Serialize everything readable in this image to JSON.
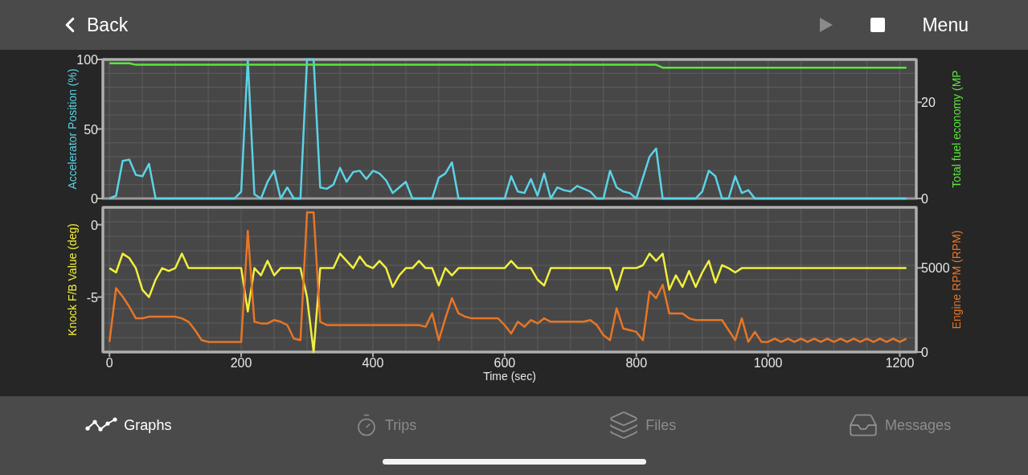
{
  "top_bar": {
    "back": {
      "label": "Back"
    },
    "play_button": {
      "disabled": true
    },
    "stop_button": {
      "disabled": false
    },
    "menu": {
      "label": "Menu"
    }
  },
  "charts": [
    {
      "chart_data": {
        "type": "line",
        "grid": true,
        "ylim": [
          0,
          100
        ],
        "yticks": [
          0,
          50,
          100
        ],
        "y2lim": [
          0,
          28.9
        ],
        "y2ticks": [
          0,
          20
        ],
        "xlim": [
          -10,
          1225
        ],
        "x": [
          0,
          10,
          20,
          30,
          40,
          50,
          60,
          70,
          80,
          90,
          100,
          110,
          120,
          130,
          140,
          150,
          160,
          170,
          180,
          190,
          200,
          210,
          220,
          230,
          240,
          250,
          260,
          270,
          280,
          290,
          300,
          310,
          320,
          330,
          340,
          350,
          360,
          370,
          380,
          390,
          400,
          410,
          420,
          430,
          440,
          450,
          460,
          470,
          480,
          490,
          500,
          510,
          520,
          530,
          540,
          550,
          560,
          570,
          580,
          590,
          600,
          610,
          620,
          630,
          640,
          650,
          660,
          670,
          680,
          690,
          700,
          710,
          720,
          730,
          740,
          750,
          760,
          770,
          780,
          790,
          800,
          810,
          820,
          830,
          840,
          850,
          860,
          870,
          880,
          890,
          900,
          910,
          920,
          930,
          940,
          950,
          960,
          970,
          980,
          990,
          1000,
          1010,
          1020,
          1030,
          1040,
          1050,
          1060,
          1070,
          1080,
          1090,
          1100,
          1110,
          1120,
          1130,
          1140,
          1150,
          1160,
          1170,
          1180,
          1190,
          1200,
          1210
        ],
        "series": [
          {
            "name": "Accelerator Position (%)",
            "color": "#5bd3e6",
            "values": [
              0,
              2,
              27,
              28,
              17,
              16,
              25,
              0,
              0,
              0,
              0,
              0,
              0,
              0,
              0,
              0,
              0,
              0,
              0,
              0,
              5,
              100,
              3,
              0,
              12,
              20,
              0,
              8,
              0,
              0,
              100,
              100,
              8,
              7,
              10,
              22,
              12,
              19,
              20,
              14,
              20,
              18,
              13,
              4,
              8,
              12,
              0,
              0,
              0,
              0,
              15,
              18,
              26,
              0,
              0,
              0,
              0,
              0,
              0,
              0,
              0,
              16,
              5,
              4,
              14,
              2,
              18,
              0,
              8,
              6,
              5,
              9,
              7,
              5,
              0,
              0,
              20,
              8,
              5,
              4,
              0,
              15,
              30,
              36,
              0,
              0,
              0,
              0,
              0,
              0,
              5,
              20,
              16,
              0,
              0,
              16,
              4,
              6,
              0,
              0,
              0,
              0,
              0,
              0,
              0,
              0,
              0,
              0,
              0,
              0,
              0,
              0,
              0,
              0,
              0,
              0,
              0,
              0,
              0,
              0,
              0,
              0
            ]
          },
          {
            "name": "Total fuel economy (MP",
            "axis": "y2",
            "color": "#5ae63c",
            "values": [
              28.1,
              28.1,
              28.1,
              28.1,
              27.8,
              27.8,
              27.8,
              27.8,
              27.8,
              27.8,
              27.8,
              27.8,
              27.8,
              27.8,
              27.8,
              27.8,
              27.8,
              27.8,
              27.8,
              27.8,
              27.8,
              27.8,
              27.8,
              27.8,
              27.8,
              27.8,
              27.8,
              27.8,
              27.8,
              27.8,
              27.8,
              27.8,
              27.8,
              27.8,
              27.8,
              27.8,
              27.8,
              27.8,
              27.8,
              27.8,
              27.8,
              27.8,
              27.8,
              27.8,
              27.8,
              27.8,
              27.8,
              27.8,
              27.8,
              27.8,
              27.8,
              27.8,
              27.8,
              27.8,
              27.8,
              27.8,
              27.8,
              27.8,
              27.8,
              27.8,
              27.8,
              27.8,
              27.8,
              27.8,
              27.8,
              27.8,
              27.8,
              27.8,
              27.8,
              27.8,
              27.8,
              27.8,
              27.8,
              27.8,
              27.8,
              27.8,
              27.8,
              27.8,
              27.8,
              27.8,
              27.8,
              27.8,
              27.8,
              27.8,
              27.2,
              27.2,
              27.2,
              27.2,
              27.2,
              27.2,
              27.2,
              27.2,
              27.2,
              27.2,
              27.2,
              27.2,
              27.2,
              27.2,
              27.2,
              27.2,
              27.2,
              27.2,
              27.2,
              27.2,
              27.2,
              27.2,
              27.2,
              27.2,
              27.2,
              27.2,
              27.2,
              27.2,
              27.2,
              27.2,
              27.2,
              27.2,
              27.2,
              27.2,
              27.2,
              27.2,
              27.2,
              27.2
            ]
          }
        ]
      }
    },
    {
      "chart_data": {
        "type": "line",
        "grid": true,
        "xlabel": "Time (sec)",
        "ylim": [
          -8.8,
          1.2
        ],
        "yticks": [
          -5,
          0
        ],
        "y2lim": [
          0,
          8600
        ],
        "y2ticks": [
          0,
          5000
        ],
        "xlim": [
          -10,
          1225
        ],
        "xticks": [
          0,
          200,
          400,
          600,
          800,
          1000,
          1200
        ],
        "x": [
          0,
          10,
          20,
          30,
          40,
          50,
          60,
          70,
          80,
          90,
          100,
          110,
          120,
          130,
          140,
          150,
          160,
          170,
          180,
          190,
          200,
          210,
          220,
          230,
          240,
          250,
          260,
          270,
          280,
          290,
          300,
          310,
          320,
          330,
          340,
          350,
          360,
          370,
          380,
          390,
          400,
          410,
          420,
          430,
          440,
          450,
          460,
          470,
          480,
          490,
          500,
          510,
          520,
          530,
          540,
          550,
          560,
          570,
          580,
          590,
          600,
          610,
          620,
          630,
          640,
          650,
          660,
          670,
          680,
          690,
          700,
          710,
          720,
          730,
          740,
          750,
          760,
          770,
          780,
          790,
          800,
          810,
          820,
          830,
          840,
          850,
          860,
          870,
          880,
          890,
          900,
          910,
          920,
          930,
          940,
          950,
          960,
          970,
          980,
          990,
          1000,
          1010,
          1020,
          1030,
          1040,
          1050,
          1060,
          1070,
          1080,
          1090,
          1100,
          1110,
          1120,
          1130,
          1140,
          1150,
          1160,
          1170,
          1180,
          1190,
          1200,
          1210
        ],
        "series": [
          {
            "name": "Knock F/B Value (deg)",
            "color": "#f2ef3c",
            "values": [
              -3,
              -3.3,
              -2,
              -2.3,
              -3,
              -4.5,
              -5,
              -3.8,
              -3,
              -3.2,
              -3,
              -2,
              -3,
              -3,
              -3,
              -3,
              -3,
              -3,
              -3,
              -3,
              -3,
              -6,
              -3,
              -3.5,
              -2.5,
              -3.5,
              -3,
              -3,
              -3,
              -3,
              -5,
              -8.8,
              -3,
              -3,
              -3,
              -2,
              -2.5,
              -3,
              -2.2,
              -2.8,
              -3,
              -2.5,
              -3,
              -4.3,
              -3.5,
              -3,
              -3,
              -2.5,
              -3,
              -3,
              -4.2,
              -3,
              -3.5,
              -3,
              -3,
              -3,
              -3,
              -3,
              -3,
              -3,
              -3,
              -2.5,
              -3,
              -3,
              -3,
              -3.8,
              -4.2,
              -3,
              -3,
              -3,
              -3,
              -3,
              -3,
              -3,
              -3,
              -3,
              -3,
              -4.5,
              -3,
              -3,
              -3,
              -2.8,
              -2,
              -2.5,
              -2,
              -4.5,
              -3.5,
              -4.3,
              -3.2,
              -4.3,
              -3.3,
              -2.5,
              -4,
              -2.8,
              -3,
              -3.3,
              -3,
              -3,
              -3,
              -3,
              -3,
              -3,
              -3,
              -3,
              -3,
              -3,
              -3,
              -3,
              -3,
              -3,
              -3,
              -3,
              -3,
              -3,
              -3,
              -3,
              -3,
              -3,
              -3,
              -3,
              -3,
              -3
            ]
          },
          {
            "name": "Engine RPM (RPM)",
            "axis": "y2",
            "color": "#e87526",
            "values": [
              600,
              3800,
              3300,
              2700,
              2000,
              2000,
              2100,
              2100,
              2100,
              2100,
              2100,
              2000,
              1800,
              1300,
              700,
              600,
              600,
              600,
              600,
              600,
              600,
              7200,
              1800,
              1700,
              1700,
              1900,
              1800,
              1600,
              800,
              700,
              8300,
              8300,
              1800,
              1600,
              1600,
              1600,
              1600,
              1600,
              1600,
              1600,
              1600,
              1600,
              1600,
              1600,
              1600,
              1600,
              1600,
              1600,
              1500,
              2300,
              700,
              2000,
              3200,
              2300,
              2100,
              2000,
              2000,
              2000,
              2000,
              2000,
              1600,
              1100,
              1800,
              1500,
              1900,
              1700,
              2000,
              1800,
              1800,
              1800,
              1800,
              1800,
              1800,
              1900,
              1600,
              1000,
              700,
              2600,
              1400,
              1300,
              1200,
              700,
              3600,
              3200,
              4000,
              2300,
              2300,
              2300,
              2000,
              1900,
              1900,
              1900,
              1900,
              1900,
              1300,
              700,
              2000,
              600,
              1200,
              600,
              600,
              800,
              600,
              800,
              600,
              800,
              600,
              800,
              600,
              800,
              600,
              800,
              600,
              800,
              600,
              800,
              600,
              800,
              600,
              800,
              600,
              800
            ]
          }
        ]
      }
    }
  ],
  "tabs": [
    {
      "label": "Graphs",
      "selected": true
    },
    {
      "label": "Trips",
      "selected": false
    },
    {
      "label": "Files",
      "selected": false
    },
    {
      "label": "Messages",
      "selected": false
    }
  ]
}
